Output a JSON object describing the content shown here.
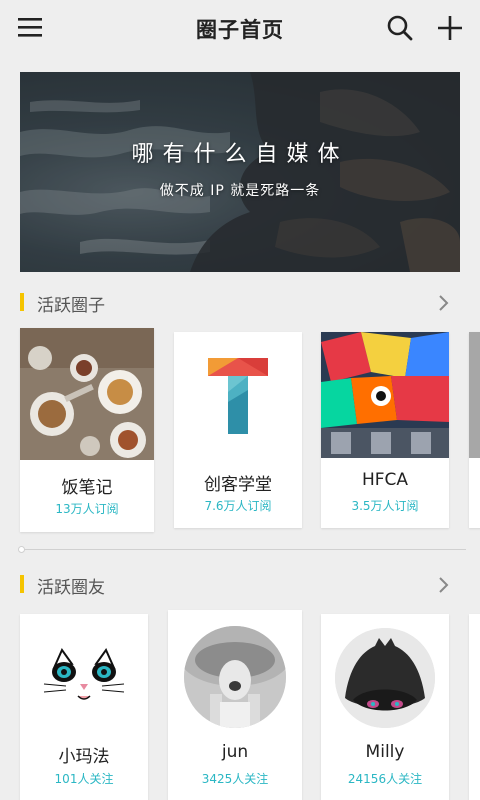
{
  "header": {
    "title": "圈子首页",
    "menu_icon": "hamburger-menu-icon",
    "search_icon": "search-icon",
    "add_icon": "plus-icon"
  },
  "banner": {
    "headline": "哪有什么自媒体",
    "subtitle": "做不成 IP 就是死路一条"
  },
  "sections": {
    "circles": {
      "title": "活跃圈子",
      "items": [
        {
          "name": "饭笔记",
          "meta": "13万人订阅"
        },
        {
          "name": "创客学堂",
          "meta": "7.6万人订阅"
        },
        {
          "name": "HFCA",
          "meta": "3.5万人订阅"
        }
      ]
    },
    "friends": {
      "title": "活跃圈友",
      "items": [
        {
          "name": "小玛法",
          "meta": "101人关注"
        },
        {
          "name": "jun",
          "meta": "3425人关注"
        },
        {
          "name": "Milly",
          "meta": "24156人关注"
        }
      ]
    }
  },
  "colors": {
    "accent": "#f5c400",
    "meta_text": "#2bb7c4",
    "background": "#eeeeee"
  }
}
